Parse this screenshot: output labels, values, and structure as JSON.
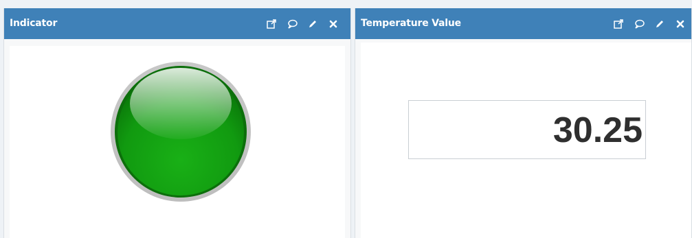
{
  "widgets": [
    {
      "title": "Indicator",
      "type": "indicator",
      "state": "on",
      "indicator_color": "#16a314",
      "tools": [
        "external-link-icon",
        "comment-icon",
        "pencil-icon",
        "close-icon"
      ]
    },
    {
      "title": "Temperature Value",
      "type": "value",
      "value": "30.25",
      "tools": [
        "external-link-icon",
        "comment-icon",
        "pencil-icon",
        "close-icon"
      ]
    }
  ],
  "colors": {
    "header": "#3f81b8",
    "indicator_on": "#16a314"
  }
}
